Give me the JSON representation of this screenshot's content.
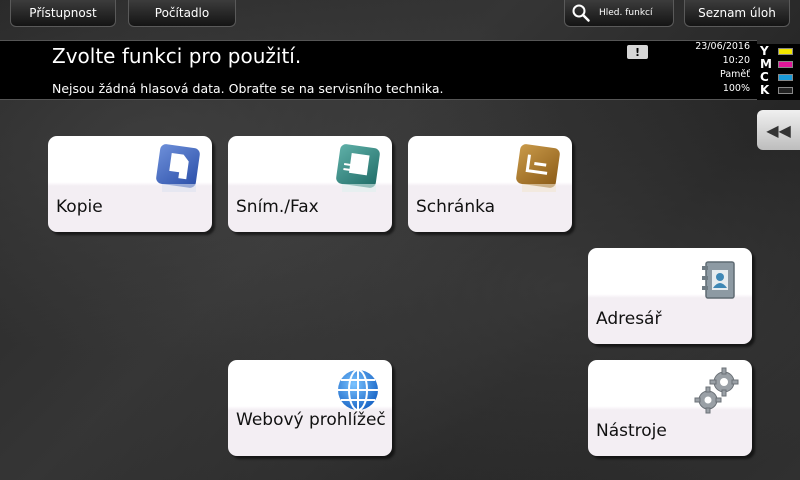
{
  "topbar": {
    "accessibility": "Přístupnost",
    "counter": "Počítadlo",
    "search": "Hled. funkcí",
    "job_list": "Seznam úloh"
  },
  "message": {
    "title": "Zvolte funkci pro použití.",
    "subtitle": "Nejsou žádná hlasová data. Obraťte se na servisního technika.",
    "warning_icon": "!"
  },
  "status": {
    "date": "23/06/2016",
    "time": "10:20",
    "memory_label": "Paměť",
    "memory_value": "100%"
  },
  "toner": [
    {
      "letter": "Y",
      "color": "#f2e600"
    },
    {
      "letter": "M",
      "color": "#e0179a"
    },
    {
      "letter": "C",
      "color": "#1a9ad8"
    },
    {
      "letter": "K",
      "color": "#222222"
    }
  ],
  "side_tab": "◀◀",
  "tiles": {
    "copy": "Kopie",
    "scan_fax": "Sním./Fax",
    "box": "Schránka",
    "address_book": "Adresář",
    "web_browser": "Webový prohlížeč",
    "tools": "Nástroje"
  },
  "icons": {
    "copy": "copy-icon",
    "scan_fax": "scan-fax-icon",
    "box": "user-box-icon",
    "address_book": "address-book-icon",
    "web_browser": "globe-icon",
    "tools": "gears-icon"
  }
}
